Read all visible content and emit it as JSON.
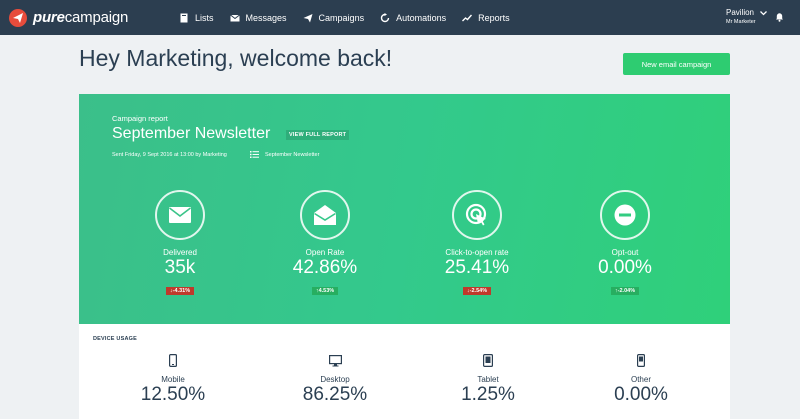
{
  "brand": {
    "bold": "pure",
    "light": "campaign"
  },
  "nav": {
    "items": [
      {
        "label": "Lists",
        "icon": "book-icon"
      },
      {
        "label": "Messages",
        "icon": "envelope-icon"
      },
      {
        "label": "Campaigns",
        "icon": "paper-plane-icon"
      },
      {
        "label": "Automations",
        "icon": "refresh-icon"
      },
      {
        "label": "Reports",
        "icon": "trend-icon"
      }
    ],
    "user": {
      "name": "Pavilion",
      "role": "Mr Marketer"
    }
  },
  "page": {
    "heading": "Hey Marketing, welcome back!",
    "new_button": "New email campaign"
  },
  "report": {
    "label": "Campaign report",
    "title": "September Newsletter",
    "view_full": "VIEW FULL REPORT",
    "sent": "Sent Friday, 9 Sept 2016 at 13:00 by Marketing",
    "list_name": "September Newsletter",
    "metrics": [
      {
        "label": "Delivered",
        "value": "35k",
        "change": "↓-4.31%",
        "direction": "down"
      },
      {
        "label": "Open Rate",
        "value": "42.86%",
        "change": "↑4.53%",
        "direction": "up"
      },
      {
        "label": "Click-to-open rate",
        "value": "25.41%",
        "change": "↓-2.54%",
        "direction": "down"
      },
      {
        "label": "Opt-out",
        "value": "0.00%",
        "change": "↑-2.04%",
        "direction": "up"
      }
    ]
  },
  "device_usage": {
    "label": "DEVICE USAGE",
    "items": [
      {
        "name": "Mobile",
        "value": "12.50%"
      },
      {
        "name": "Desktop",
        "value": "86.25%"
      },
      {
        "name": "Tablet",
        "value": "1.25%"
      },
      {
        "name": "Other",
        "value": "0.00%"
      }
    ]
  },
  "colors": {
    "nav_bg": "#2c3e50",
    "accent_green": "#2ecc71",
    "brand_red": "#e74c3c",
    "down": "#c0392b",
    "up": "#27ae60"
  }
}
